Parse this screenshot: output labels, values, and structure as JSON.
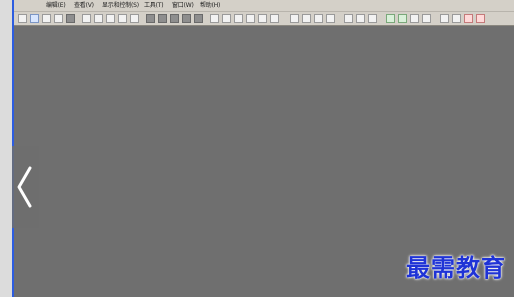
{
  "menubar": {
    "items": [
      {
        "label": "编辑(E)"
      },
      {
        "label": "查看(V)"
      },
      {
        "label": "显示和控制(S)"
      },
      {
        "label": "工具(T)"
      },
      {
        "label": "窗口(W)"
      },
      {
        "label": "帮助(H)"
      }
    ]
  },
  "toolbar": {
    "icons": [
      "pointer-icon",
      "new-file-icon",
      "open-folder-icon",
      "save-icon",
      "print-icon",
      "separator",
      "cut-icon",
      "copy-icon",
      "paste-icon",
      "undo-icon",
      "redo-icon",
      "zoom-in-icon",
      "zoom-out-icon",
      "zoom-fit-icon",
      "settings-icon"
    ]
  },
  "watermark": {
    "text": "最需教育"
  },
  "colors": {
    "workspace": "#6f6f6f",
    "toolbar": "#d4d0c8",
    "accent_blue": "#1f33d6",
    "frame_blue": "#2d5de0",
    "app_icon": "#ff8a2a"
  }
}
